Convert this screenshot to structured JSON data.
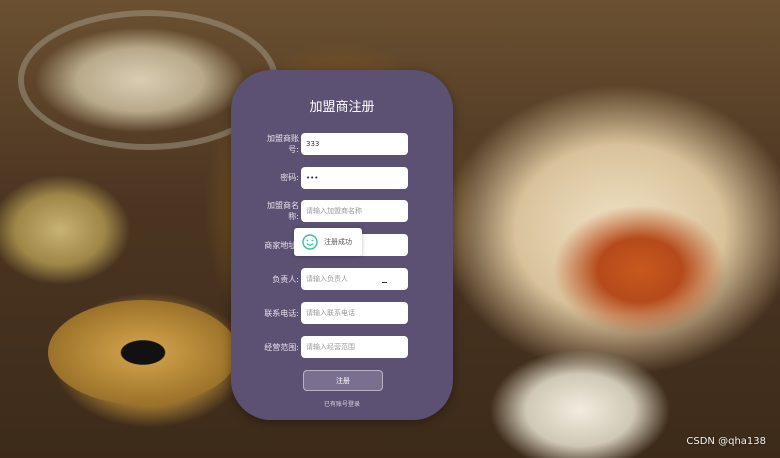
{
  "form": {
    "title": "加盟商注册",
    "fields": [
      {
        "label_line1": "加盟商账",
        "label_line2": "号:",
        "value": "333",
        "placeholder": ""
      },
      {
        "label_line1": "密码:",
        "label_line2": "",
        "value": "•••",
        "placeholder": ""
      },
      {
        "label_line1": "加盟商名",
        "label_line2": "称:",
        "value": "",
        "placeholder": "请输入加盟商名称"
      },
      {
        "label_line1": "商家地址:",
        "label_line2": "",
        "value": "",
        "placeholder": ""
      },
      {
        "label_line1": "负责人:",
        "label_line2": "",
        "value": "",
        "placeholder": "请输入负责人"
      },
      {
        "label_line1": "联系电话:",
        "label_line2": "",
        "value": "",
        "placeholder": "请输入联系电话"
      },
      {
        "label_line1": "经营范围:",
        "label_line2": "",
        "value": "",
        "placeholder": "请输入经营范围"
      }
    ],
    "submit_label": "注册",
    "bottom_link": "已有账号登录"
  },
  "toast": {
    "message": "注册成功",
    "icon": "smile-icon",
    "color": "#35c49b"
  },
  "watermark": "CSDN @qha138",
  "colors": {
    "card": "#5d5173",
    "button": "#7a6f8e"
  }
}
